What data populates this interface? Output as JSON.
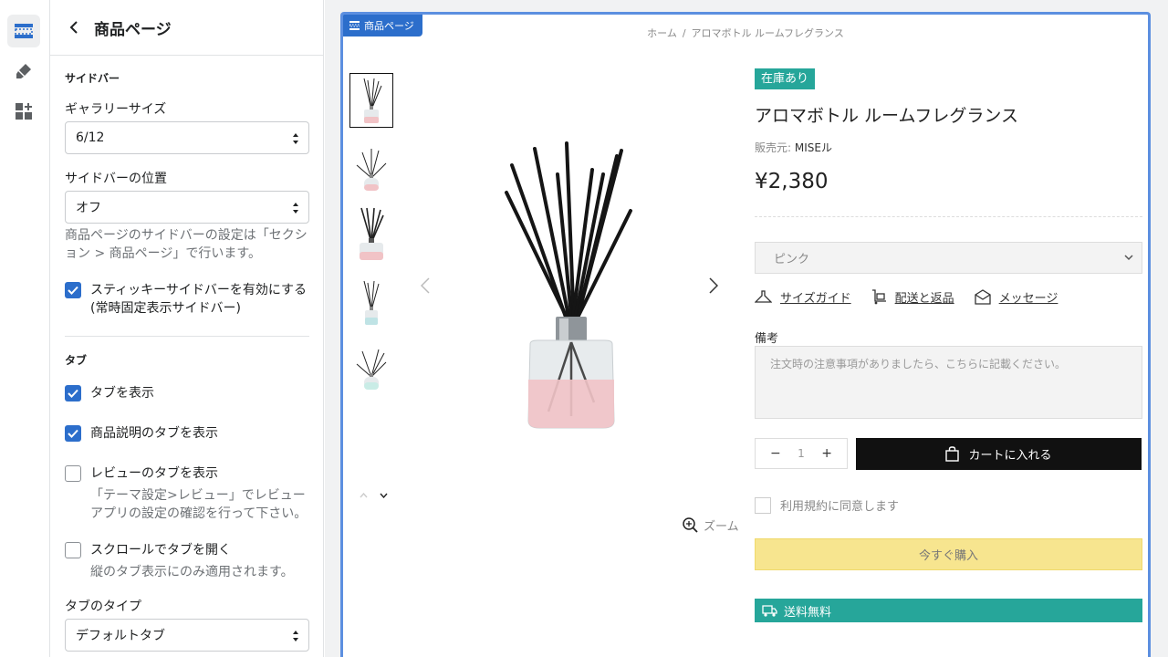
{
  "rail": {
    "items": [
      {
        "icon": "sections-icon",
        "active": true
      },
      {
        "icon": "theme-brush-icon",
        "active": false
      },
      {
        "icon": "apps-icon",
        "active": false
      }
    ]
  },
  "panel": {
    "title": "商品ページ",
    "sidebar_section": "サイドバー",
    "gallery_size_label": "ギャラリーサイズ",
    "gallery_size_value": "6/12",
    "sidebar_position_label": "サイドバーの位置",
    "sidebar_position_value": "オフ",
    "sidebar_help": "商品ページのサイドバーの設定は「セクション > 商品ページ」で行います。",
    "sticky_sidebar_label": "スティッキーサイドバーを有効にする (常時固定表示サイドバー)",
    "sticky_sidebar_checked": true,
    "tabs_section": "タブ",
    "show_tabs_label": "タブを表示",
    "show_tabs_checked": true,
    "show_desc_tab_label": "商品説明のタブを表示",
    "show_desc_tab_checked": true,
    "show_review_tab_label": "レビューのタブを表示",
    "show_review_tab_checked": false,
    "review_help": "「テーマ設定>レビュー」でレビューアプリの設定の確認を行って下さい。",
    "scroll_open_label": "スクロールでタブを開く",
    "scroll_open_checked": false,
    "scroll_open_help": "縦のタブ表示にのみ適用されます。",
    "tab_type_label": "タブのタイプ",
    "tab_type_value": "デフォルトタブ"
  },
  "preview": {
    "section_badge": "商品ページ",
    "breadcrumb": {
      "home": "ホーム",
      "separator": "/",
      "current": "アロマボトル ルームフレグランス"
    },
    "thumbnails": [
      {
        "liquid": "#f1c3c6",
        "active": true
      },
      {
        "liquid": "#f1c3c6",
        "active": false
      },
      {
        "liquid": "#f1c3c6",
        "active": false
      },
      {
        "liquid": "#bfe3e5",
        "active": false
      },
      {
        "liquid": "#c9ece6",
        "active": false
      }
    ],
    "zoom_label": "ズーム",
    "product": {
      "stock_badge": "在庫あり",
      "title": "アロマボトル ルームフレグランス",
      "vendor_label": "販売元:",
      "vendor": "MISEル",
      "price": "¥2,380",
      "variant": "ピンク",
      "links": {
        "size_guide": "サイズガイド",
        "shipping": "配送と返品",
        "message": "メッセージ"
      },
      "notes_label": "備考",
      "notes_placeholder": "注文時の注意事項がありましたら、こちらに記載ください。",
      "quantity": "1",
      "qty_minus": "−",
      "qty_plus": "+",
      "add_to_cart": "カートに入れる",
      "terms": "利用規約に同意します",
      "buy_now": "今すぐ購入",
      "free_shipping": "送料無料"
    }
  },
  "colors": {
    "accent": "#2c6ecb",
    "teal": "#26a69a",
    "buy_yellow": "#f7e58f",
    "bottle_pink": "#f1c3c6"
  }
}
